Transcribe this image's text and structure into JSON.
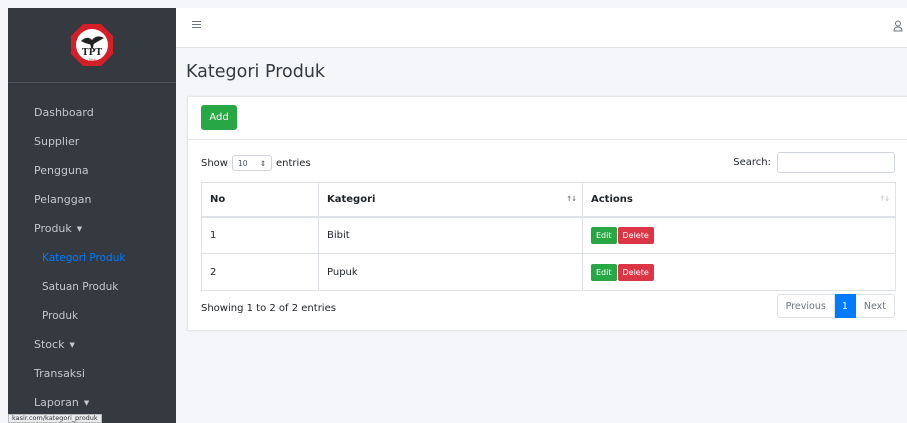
{
  "logo": {
    "text": "TPT",
    "subtext": "TANI",
    "colors": {
      "ring": "#d41f26",
      "inner": "#ffffff"
    }
  },
  "sidebar": {
    "items": [
      {
        "label": "Dashboard"
      },
      {
        "label": "Supplier"
      },
      {
        "label": "Pengguna"
      },
      {
        "label": "Pelanggan"
      },
      {
        "label": "Produk",
        "caret": "▼"
      },
      {
        "label": "Kategori Produk"
      },
      {
        "label": "Satuan Produk"
      },
      {
        "label": "Produk"
      },
      {
        "label": "Stock",
        "caret": "▼"
      },
      {
        "label": "Transaksi"
      },
      {
        "label": "Laporan",
        "caret": "▼"
      }
    ]
  },
  "status_bar": {
    "url": "kasir.com/kategori_produk"
  },
  "header": {
    "menu_icon": "hamburger-icon",
    "user_icon": "user-icon"
  },
  "page": {
    "title": "Kategori Produk"
  },
  "toolbar": {
    "add_label": "Add"
  },
  "table_controls": {
    "show_label": "Show",
    "page_size": "10",
    "entries_label": "entries",
    "search_label": "Search:",
    "search_value": ""
  },
  "table": {
    "columns": [
      "No",
      "Kategori",
      "Actions"
    ],
    "sort_icon": "↑↓",
    "rows": [
      {
        "no": "1",
        "kategori": "Bibit"
      },
      {
        "no": "2",
        "kategori": "Pupuk"
      }
    ],
    "edit_label": "Edit",
    "delete_label": "Delete"
  },
  "footer": {
    "info": "Showing 1 to 2 of 2 entries"
  },
  "pagination": {
    "previous": "Previous",
    "current": "1",
    "next": "Next"
  },
  "colors": {
    "sidebar": "#343a40",
    "primary": "#007bff",
    "success": "#28a745",
    "danger": "#dc3545"
  }
}
